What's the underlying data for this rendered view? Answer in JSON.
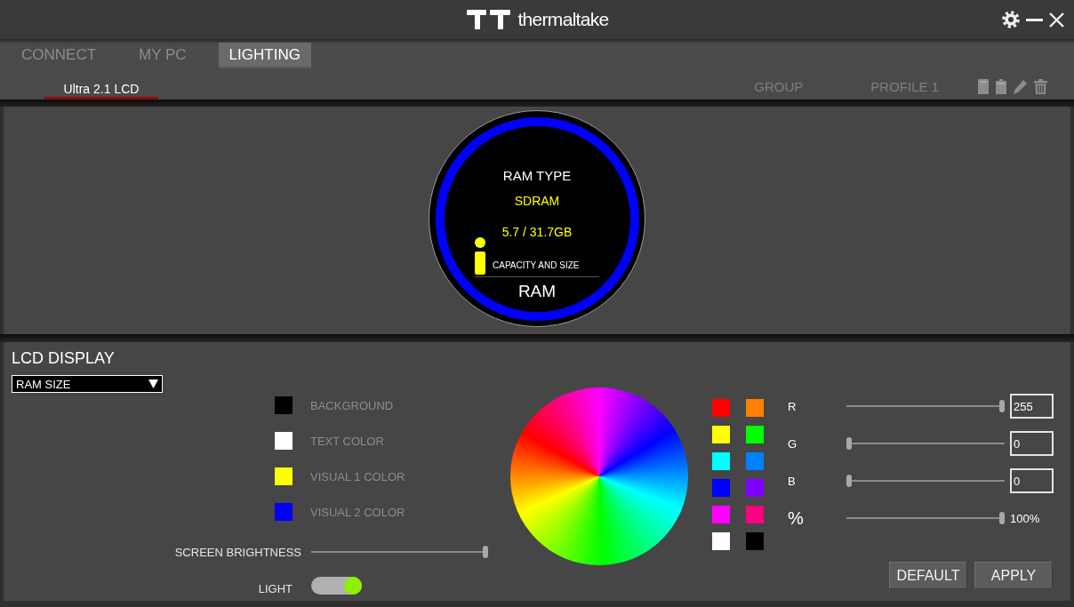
{
  "title_bar": {
    "brand": "thermaltake"
  },
  "nav_tabs": [
    {
      "label": "CONNECT",
      "selected": false
    },
    {
      "label": "MY PC",
      "selected": false
    },
    {
      "label": "LIGHTING",
      "selected": true
    }
  ],
  "device_tabs": [
    {
      "label": "Ultra 2.1 LCD",
      "selected": true
    }
  ],
  "profile_bar": {
    "group": "GROUP",
    "profile": "PROFILE 1"
  },
  "lcd_preview": {
    "title": "RAM TYPE",
    "value": "SDRAM",
    "reading": "5.7 / 31.7GB",
    "caption": "CAPACITY AND SIZE",
    "footer": "RAM"
  },
  "lcd_display": {
    "title": "LCD DISPLAY",
    "mode": "RAM SIZE",
    "color_settings": [
      {
        "label": "BACKGROUND",
        "color": "#000000"
      },
      {
        "label": "TEXT COLOR",
        "color": "#ffffff"
      },
      {
        "label": "VISUAL 1 COLOR",
        "color": "#ffff00"
      },
      {
        "label": "VISUAL 2 COLOR",
        "color": "#0000ff"
      }
    ],
    "screen_brightness": {
      "label": "SCREEN BRIGHTNESS",
      "level": 1
    },
    "light": {
      "label": "LIGHT",
      "on": true
    }
  },
  "palette": [
    {
      "color": "#ff0000"
    },
    {
      "color": "#ff8000"
    },
    {
      "color": "#ffff00"
    },
    {
      "color": "#00ff00"
    },
    {
      "color": "#00ffff"
    },
    {
      "color": "#0080ff"
    },
    {
      "color": "#0000ff"
    },
    {
      "color": "#8000ff"
    },
    {
      "color": "#ff00ff"
    },
    {
      "color": "#ff0080"
    },
    {
      "color": "#ffffff"
    },
    {
      "color": "#000000"
    }
  ],
  "rgb_channels": [
    {
      "label": "R",
      "level": 1,
      "value": "255"
    },
    {
      "label": "G",
      "level": 0,
      "value": "0"
    },
    {
      "label": "B",
      "level": 0,
      "value": "0"
    }
  ],
  "intensity": {
    "label": "%",
    "level": 1,
    "reading": "100%"
  },
  "buttons": [
    {
      "label": "DEFAULT"
    },
    {
      "label": "APPLY"
    }
  ]
}
